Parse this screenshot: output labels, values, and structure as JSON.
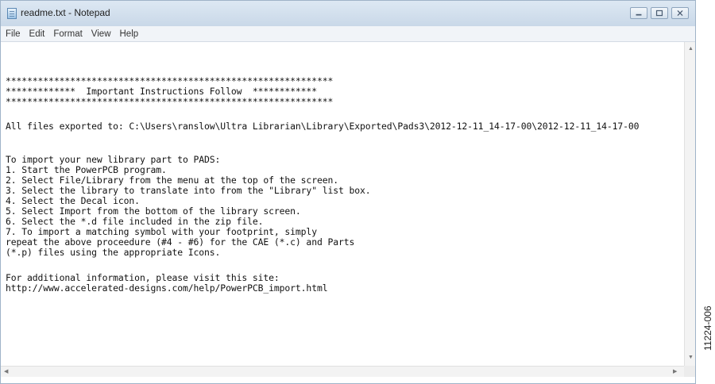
{
  "window": {
    "title": "readme.txt - Notepad",
    "icon": "notepad-icon",
    "controls": [
      "minimize-icon",
      "maximize-icon",
      "close-icon"
    ]
  },
  "menu": [
    "File",
    "Edit",
    "Format",
    "View",
    "Help"
  ],
  "editor": {
    "lines": [
      "*************************************************************",
      "*************  Important Instructions Follow  ************",
      "*************************************************************",
      "All files exported to: C:\\Users\\ranslow\\Ultra Librarian\\Library\\Exported\\Pads3\\2012-12-11_14-17-00\\2012-12-11_14-17-00",
      "To import your new library part to PADS:",
      "1. Start the PowerPCB program.",
      "2. Select File/Library from the menu at the top of the screen.",
      "3. Select the library to translate into from the \"Library\" list box.",
      "4. Select the Decal icon.",
      "5. Select Import from the bottom of the library screen.",
      "6. Select the *.d file included in the zip file.",
      "7. To import a matching symbol with your footprint, simply",
      "repeat the above proceedure (#4 - #6) for the CAE (*.c) and Parts",
      "(*.p) files using the appropriate Icons.",
      "For additional information, please visit this site:",
      "http://www.accelerated-designs.com/help/PowerPCB_import.html"
    ]
  },
  "figure_id": "11224-006"
}
